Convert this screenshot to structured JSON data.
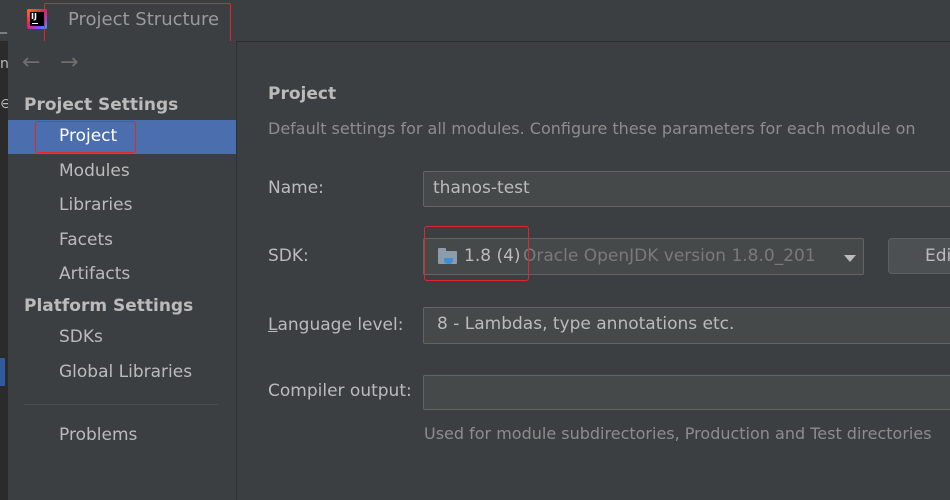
{
  "window": {
    "title": "Project Structure"
  },
  "nav": {
    "back_icon": "←",
    "forward_icon": "→"
  },
  "sidebar": {
    "project_settings_header": "Project Settings",
    "project_items": [
      "Project",
      "Modules",
      "Libraries",
      "Facets",
      "Artifacts"
    ],
    "platform_settings_header": "Platform Settings",
    "platform_items": [
      "SDKs",
      "Global Libraries"
    ],
    "problems": "Problems",
    "selected": "Project"
  },
  "main": {
    "heading": "Project",
    "description": "Default settings for all modules. Configure these parameters for each module on",
    "name_label": "Name:",
    "name_value": "thanos-test",
    "sdk_label": "SDK:",
    "sdk_version": "1.8 (4)",
    "sdk_description": "Oracle OpenJDK version 1.8.0_201",
    "edit_button": "Edit",
    "language_label_prefix": "L",
    "language_label_rest": "anguage level:",
    "language_value": "8 - Lambdas, type annotations etc.",
    "compiler_label": "Compiler output:",
    "compiler_value": "",
    "compiler_hint": "Used for module subdirectories, Production and Test directories"
  },
  "colors": {
    "selection": "#4b6eaf",
    "highlight_box": "#e0272b",
    "background": "#3c3f41"
  }
}
